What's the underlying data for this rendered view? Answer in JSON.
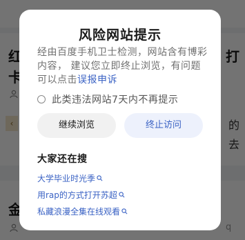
{
  "background": {
    "card1_title_lines": [
      "红",
      "卡"
    ],
    "card1_right_lines": [
      "打",
      "的",
      "去"
    ],
    "card2_title": "金",
    "card2_meta": "q"
  },
  "dialog": {
    "title": "风险网站提示",
    "body_text": "经由百度手机卫士检测，网站含有博彩内容， 建议您立即终止浏览，有问题可以点击",
    "report_link": "误报申诉",
    "checkbox_label": "此类违法网站7天内不再提示",
    "continue_button": "继续浏览",
    "stop_button": "终止访问",
    "section_title": "大家还在搜",
    "suggestions": [
      "大学毕业时光季",
      "用rap的方式打开苏超",
      "私藏浪漫全集在线观看"
    ]
  },
  "colors": {
    "link": "#3a62c4",
    "overlay": "rgba(0,0,0,0.55)"
  }
}
